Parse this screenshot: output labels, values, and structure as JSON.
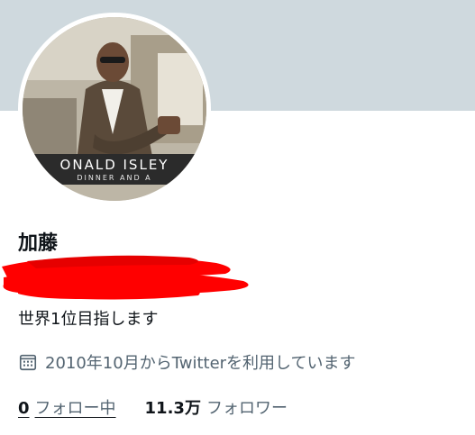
{
  "profile": {
    "avatar_caption_main": "ONALD ISLEY",
    "avatar_caption_sub": "DINNER AND A",
    "display_name": "加藤",
    "bio": "世界1位目指します",
    "joined": "2010年10月からTwitterを利用しています",
    "following_count": "0",
    "following_label": "フォロー中",
    "followers_count": "11.3万",
    "followers_label": "フォロワー"
  },
  "colors": {
    "banner": "#cfd9de",
    "redaction": "#ff0000",
    "secondary_text": "#536471"
  },
  "icons": {
    "joined": "calendar-icon"
  }
}
